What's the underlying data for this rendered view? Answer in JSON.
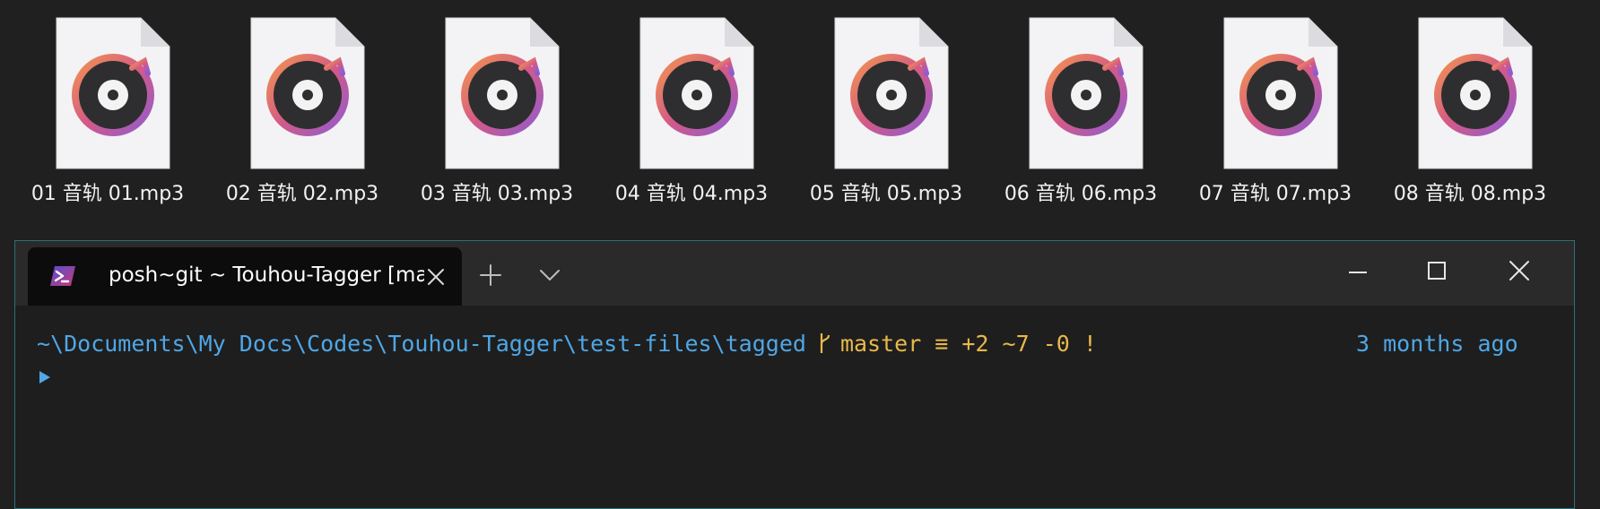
{
  "files": [
    {
      "name": "01 音轨 01.mp3"
    },
    {
      "name": "02 音轨 02.mp3"
    },
    {
      "name": "03 音轨 03.mp3"
    },
    {
      "name": "04 音轨 04.mp3"
    },
    {
      "name": "05 音轨 05.mp3"
    },
    {
      "name": "06 音轨 06.mp3"
    },
    {
      "name": "07 音轨 07.mp3"
    },
    {
      "name": "08 音轨 08.mp3"
    }
  ],
  "file_icon": "music-file-icon",
  "terminal": {
    "tab_title": "posh~git ~ Touhou-Tagger [master]",
    "tab_icon": "powershell-icon",
    "prompt": {
      "path": "~\\Documents\\My Docs\\Codes\\Touhou-Tagger\\test-files\\tagged",
      "branch_glyph": "",
      "git_status": "master ≡ +2 ~7 -0 !",
      "time": "3 months ago"
    }
  },
  "colors": {
    "desktop_bg": "#202020",
    "terminal_bg": "#1e1e1e",
    "path": "#4fa7e6",
    "git": "#e8b84a",
    "accent_border": "#2f6f7a"
  }
}
